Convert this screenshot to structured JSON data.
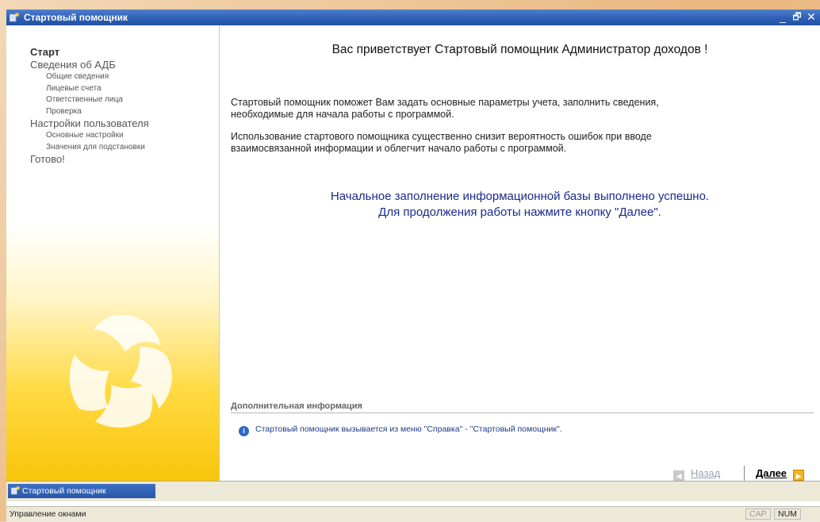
{
  "window": {
    "title": "Стартовый помощник",
    "controls": {
      "minimize": "_",
      "restore": "🗗",
      "close": "✕"
    }
  },
  "sidebar": {
    "items": [
      {
        "label": "Старт",
        "level": 1,
        "active": true
      },
      {
        "label": "Сведения об АДБ",
        "level": 1
      },
      {
        "label": "Общие сведения",
        "level": 2
      },
      {
        "label": "Лицевые счета",
        "level": 2
      },
      {
        "label": "Ответственные лица",
        "level": 2
      },
      {
        "label": "Проверка",
        "level": 2
      },
      {
        "label": "Настройки пользователя",
        "level": 1
      },
      {
        "label": "Основные настройки",
        "level": 2
      },
      {
        "label": "Значения для подстановки",
        "level": 2
      },
      {
        "label": "Готово!",
        "level": 1
      }
    ]
  },
  "main": {
    "welcome": "Вас приветствует Стартовый помощник Администратор доходов !",
    "intro1_line1": "Стартовый помощник поможет Вам задать основные параметры учета, заполнить сведения,",
    "intro1_line2": "необходимые для начала работы с программой.",
    "intro2_line1": "Использование стартового помощника существенно снизит вероятность ошибок при вводе",
    "intro2_line2": "взаимосвязанной информации и облегчит начало работы с программой.",
    "success_line1": "Начальное заполнение информационной базы выполнено успешно.",
    "success_line2": "Для продолжения работы нажмите кнопку \"Далее\".",
    "info_header": "Дополнительная информация",
    "info_text": "Стартовый помощник вызывается из меню \"Справка\" - \"Стартовый помощник\".",
    "back_label": "Назад",
    "next_label": "Далее"
  },
  "taskbar": {
    "button_label": "Стартовый помощник"
  },
  "statusbar": {
    "text": "Управление окнами",
    "cap": "CAP",
    "num": "NUM"
  },
  "colors": {
    "titlebar": "#2d5fb5",
    "accent_yellow": "#f7c100",
    "success_text": "#1a2a8e"
  }
}
